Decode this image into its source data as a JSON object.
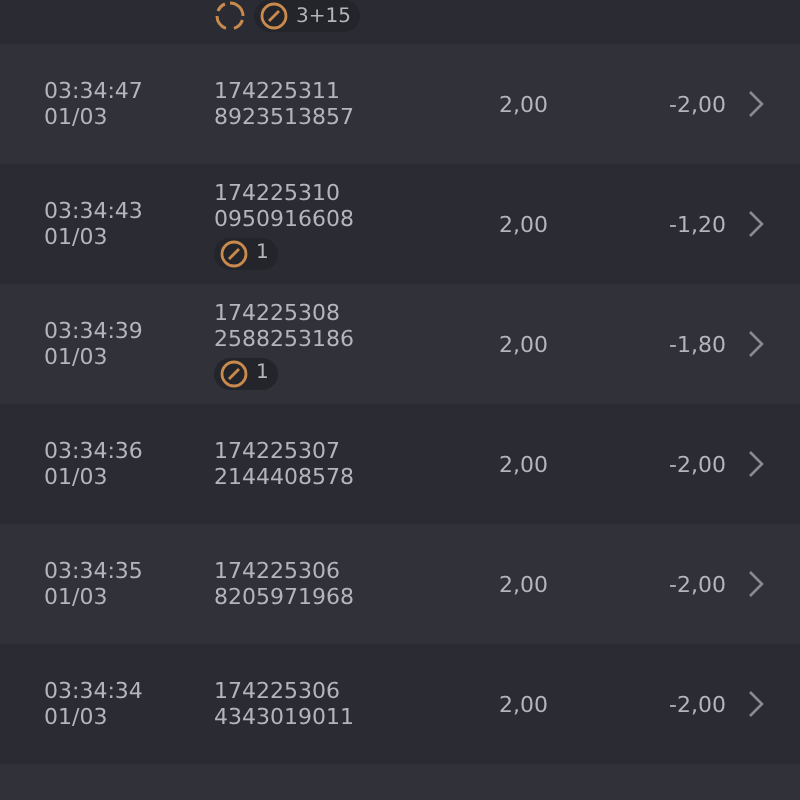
{
  "rows": [
    {
      "badges": [
        {
          "kind": "spinner"
        },
        {
          "kind": "count",
          "text": "3+15"
        }
      ]
    },
    {
      "time": "03:34:47",
      "date": "01/03",
      "id": "174225311",
      "ref": "8923513857",
      "stake": "2,00",
      "net": "-2,00",
      "badges": []
    },
    {
      "time": "03:34:43",
      "date": "01/03",
      "id": "174225310",
      "ref": "0950916608",
      "stake": "2,00",
      "net": "-1,20",
      "badges": [
        {
          "kind": "count",
          "text": "1"
        }
      ]
    },
    {
      "time": "03:34:39",
      "date": "01/03",
      "id": "174225308",
      "ref": "2588253186",
      "stake": "2,00",
      "net": "-1,80",
      "badges": [
        {
          "kind": "count",
          "text": "1"
        }
      ]
    },
    {
      "time": "03:34:36",
      "date": "01/03",
      "id": "174225307",
      "ref": "2144408578",
      "stake": "2,00",
      "net": "-2,00",
      "badges": []
    },
    {
      "time": "03:34:35",
      "date": "01/03",
      "id": "174225306",
      "ref": "8205971968",
      "stake": "2,00",
      "net": "-2,00",
      "badges": []
    },
    {
      "time": "03:34:34",
      "date": "01/03",
      "id": "174225306",
      "ref": "4343019011",
      "stake": "2,00",
      "net": "-2,00",
      "badges": []
    }
  ]
}
